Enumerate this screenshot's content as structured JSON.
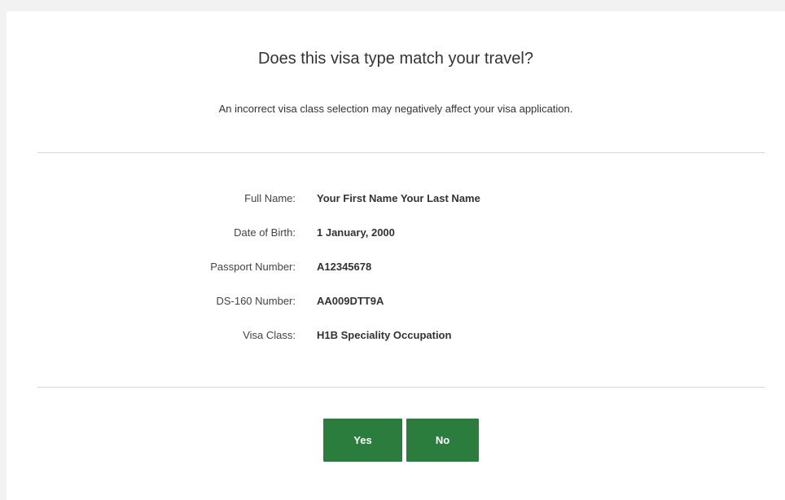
{
  "dialog": {
    "title": "Does this visa type match your travel?",
    "subtitle": "An incorrect visa class selection may negatively affect your visa application."
  },
  "details": [
    {
      "label": "Full Name:",
      "value": "Your First Name Your Last Name"
    },
    {
      "label": "Date of Birth:",
      "value": "1 January, 2000"
    },
    {
      "label": "Passport Number:",
      "value": "A12345678"
    },
    {
      "label": "DS-160 Number:",
      "value": "AA009DTT9A"
    },
    {
      "label": "Visa Class:",
      "value": "H1B Speciality Occupation"
    }
  ],
  "buttons": {
    "yes_label": "Yes",
    "no_label": "No"
  },
  "colors": {
    "button_green": "#2a7d3c",
    "page_background": "#f2f2f2",
    "card_background": "#ffffff"
  }
}
